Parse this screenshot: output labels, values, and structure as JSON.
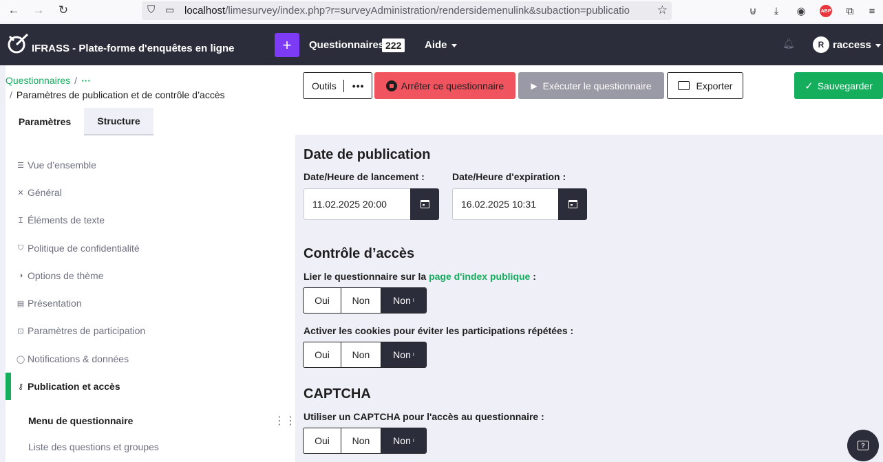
{
  "browser": {
    "url_host": "localhost",
    "url_rest": "/limesurvey/index.php?r=surveyAdministration/rendersidemenulink&subaction=publicatio"
  },
  "header": {
    "title": "IFRASS - Plate-forme d'enquêtes en ligne",
    "plus_label": "+",
    "surveys_label": "Questionnaires",
    "surveys_count": "222",
    "help_label": "Aide",
    "user_initial": "R",
    "user_name": "raccess"
  },
  "breadcrumb": {
    "root": "Questionnaires",
    "sep": "/",
    "ellipsis": "···",
    "current": "Paramètres de publication et de contrôle d’accès"
  },
  "toolbar": {
    "tools_label": "Outils",
    "tools_more": "•••",
    "stop_label": "Arrêter ce questionnaire",
    "run_label": "Exécuter le questionnaire",
    "export_label": "Exporter",
    "save_label": "Sauvegarder"
  },
  "tabs": {
    "params": "Paramètres",
    "structure": "Structure"
  },
  "sidebar": {
    "items": [
      {
        "label": "Vue d’ensemble",
        "icon": "list-icon"
      },
      {
        "label": "Général",
        "icon": "tools-icon"
      },
      {
        "label": "Éléments de texte",
        "icon": "text-icon"
      },
      {
        "label": "Politique de confidentialité",
        "icon": "shield-icon"
      },
      {
        "label": "Options de thème",
        "icon": "contrast-icon"
      },
      {
        "label": "Présentation",
        "icon": "presentation-icon"
      },
      {
        "label": "Paramètres de participation",
        "icon": "participants-icon"
      },
      {
        "label": "Notifications & données",
        "icon": "bell-icon"
      },
      {
        "label": "Publication et accès",
        "icon": "key-icon"
      }
    ],
    "menu_heading": "Menu de questionnaire",
    "menu_sub": "Liste des questions et groupes"
  },
  "publication": {
    "heading": "Date de publication",
    "start_label": "Date/Heure de lancement :",
    "start_value": "11.02.2025 20:00",
    "expiry_label": "Date/Heure d'expiration :",
    "expiry_value": "16.02.2025 10:31"
  },
  "access": {
    "heading": "Contrôle d’accès",
    "public_label_pre": "Lier le questionnaire sur la",
    "public_link": "page d'index publique",
    "public_label_post": ":",
    "cookies_label": "Activer les cookies pour éviter les participations répétées :"
  },
  "captcha": {
    "heading": "CAPTCHA",
    "label": "Utiliser un CAPTCHA pour l'accès au questionnaire :"
  },
  "toggle": {
    "yes": "Oui",
    "no": "Non",
    "inherit": "Non",
    "inherit_mark": "I"
  },
  "colors": {
    "accent_green": "#14ae5c",
    "header_dark": "#2b2d3b",
    "danger": "#f0545f",
    "purple": "#7e3bf5"
  }
}
